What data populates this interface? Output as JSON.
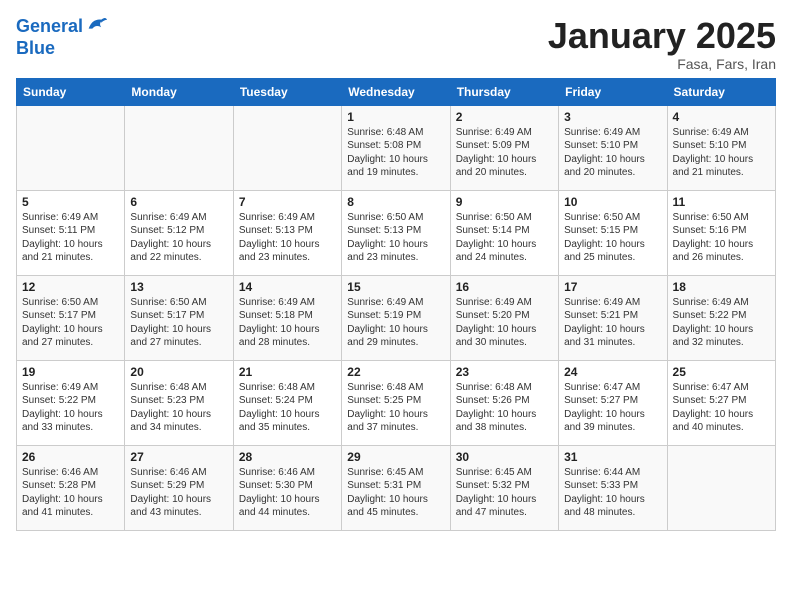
{
  "logo": {
    "line1": "General",
    "line2": "Blue"
  },
  "calendar": {
    "title": "January 2025",
    "subtitle": "Fasa, Fars, Iran"
  },
  "headers": [
    "Sunday",
    "Monday",
    "Tuesday",
    "Wednesday",
    "Thursday",
    "Friday",
    "Saturday"
  ],
  "weeks": [
    [
      {
        "day": "",
        "info": ""
      },
      {
        "day": "",
        "info": ""
      },
      {
        "day": "",
        "info": ""
      },
      {
        "day": "1",
        "info": "Sunrise: 6:48 AM\nSunset: 5:08 PM\nDaylight: 10 hours\nand 19 minutes."
      },
      {
        "day": "2",
        "info": "Sunrise: 6:49 AM\nSunset: 5:09 PM\nDaylight: 10 hours\nand 20 minutes."
      },
      {
        "day": "3",
        "info": "Sunrise: 6:49 AM\nSunset: 5:10 PM\nDaylight: 10 hours\nand 20 minutes."
      },
      {
        "day": "4",
        "info": "Sunrise: 6:49 AM\nSunset: 5:10 PM\nDaylight: 10 hours\nand 21 minutes."
      }
    ],
    [
      {
        "day": "5",
        "info": "Sunrise: 6:49 AM\nSunset: 5:11 PM\nDaylight: 10 hours\nand 21 minutes."
      },
      {
        "day": "6",
        "info": "Sunrise: 6:49 AM\nSunset: 5:12 PM\nDaylight: 10 hours\nand 22 minutes."
      },
      {
        "day": "7",
        "info": "Sunrise: 6:49 AM\nSunset: 5:13 PM\nDaylight: 10 hours\nand 23 minutes."
      },
      {
        "day": "8",
        "info": "Sunrise: 6:50 AM\nSunset: 5:13 PM\nDaylight: 10 hours\nand 23 minutes."
      },
      {
        "day": "9",
        "info": "Sunrise: 6:50 AM\nSunset: 5:14 PM\nDaylight: 10 hours\nand 24 minutes."
      },
      {
        "day": "10",
        "info": "Sunrise: 6:50 AM\nSunset: 5:15 PM\nDaylight: 10 hours\nand 25 minutes."
      },
      {
        "day": "11",
        "info": "Sunrise: 6:50 AM\nSunset: 5:16 PM\nDaylight: 10 hours\nand 26 minutes."
      }
    ],
    [
      {
        "day": "12",
        "info": "Sunrise: 6:50 AM\nSunset: 5:17 PM\nDaylight: 10 hours\nand 27 minutes."
      },
      {
        "day": "13",
        "info": "Sunrise: 6:50 AM\nSunset: 5:17 PM\nDaylight: 10 hours\nand 27 minutes."
      },
      {
        "day": "14",
        "info": "Sunrise: 6:49 AM\nSunset: 5:18 PM\nDaylight: 10 hours\nand 28 minutes."
      },
      {
        "day": "15",
        "info": "Sunrise: 6:49 AM\nSunset: 5:19 PM\nDaylight: 10 hours\nand 29 minutes."
      },
      {
        "day": "16",
        "info": "Sunrise: 6:49 AM\nSunset: 5:20 PM\nDaylight: 10 hours\nand 30 minutes."
      },
      {
        "day": "17",
        "info": "Sunrise: 6:49 AM\nSunset: 5:21 PM\nDaylight: 10 hours\nand 31 minutes."
      },
      {
        "day": "18",
        "info": "Sunrise: 6:49 AM\nSunset: 5:22 PM\nDaylight: 10 hours\nand 32 minutes."
      }
    ],
    [
      {
        "day": "19",
        "info": "Sunrise: 6:49 AM\nSunset: 5:22 PM\nDaylight: 10 hours\nand 33 minutes."
      },
      {
        "day": "20",
        "info": "Sunrise: 6:48 AM\nSunset: 5:23 PM\nDaylight: 10 hours\nand 34 minutes."
      },
      {
        "day": "21",
        "info": "Sunrise: 6:48 AM\nSunset: 5:24 PM\nDaylight: 10 hours\nand 35 minutes."
      },
      {
        "day": "22",
        "info": "Sunrise: 6:48 AM\nSunset: 5:25 PM\nDaylight: 10 hours\nand 37 minutes."
      },
      {
        "day": "23",
        "info": "Sunrise: 6:48 AM\nSunset: 5:26 PM\nDaylight: 10 hours\nand 38 minutes."
      },
      {
        "day": "24",
        "info": "Sunrise: 6:47 AM\nSunset: 5:27 PM\nDaylight: 10 hours\nand 39 minutes."
      },
      {
        "day": "25",
        "info": "Sunrise: 6:47 AM\nSunset: 5:27 PM\nDaylight: 10 hours\nand 40 minutes."
      }
    ],
    [
      {
        "day": "26",
        "info": "Sunrise: 6:46 AM\nSunset: 5:28 PM\nDaylight: 10 hours\nand 41 minutes."
      },
      {
        "day": "27",
        "info": "Sunrise: 6:46 AM\nSunset: 5:29 PM\nDaylight: 10 hours\nand 43 minutes."
      },
      {
        "day": "28",
        "info": "Sunrise: 6:46 AM\nSunset: 5:30 PM\nDaylight: 10 hours\nand 44 minutes."
      },
      {
        "day": "29",
        "info": "Sunrise: 6:45 AM\nSunset: 5:31 PM\nDaylight: 10 hours\nand 45 minutes."
      },
      {
        "day": "30",
        "info": "Sunrise: 6:45 AM\nSunset: 5:32 PM\nDaylight: 10 hours\nand 47 minutes."
      },
      {
        "day": "31",
        "info": "Sunrise: 6:44 AM\nSunset: 5:33 PM\nDaylight: 10 hours\nand 48 minutes."
      },
      {
        "day": "",
        "info": ""
      }
    ]
  ]
}
